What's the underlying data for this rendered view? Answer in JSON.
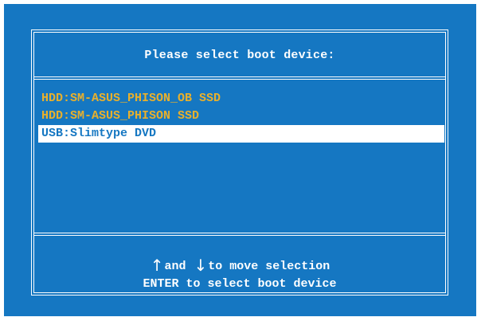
{
  "dialog": {
    "title": "Please select boot device:"
  },
  "devices": [
    {
      "label": "HDD:SM-ASUS_PHISON_OB SSD",
      "selected": false
    },
    {
      "label": "HDD:SM-ASUS_PHISON SSD",
      "selected": false
    },
    {
      "label": "USB:Slimtype DVD",
      "selected": true
    }
  ],
  "help": {
    "up_arrow": "↑",
    "and_text": "and",
    "down_arrow": "↓",
    "move_text": "to move selection",
    "enter_text": "ENTER to select boot device"
  },
  "colors": {
    "background": "#1577c2",
    "foreground": "#ffffff",
    "unselected_item": "#e8b02c",
    "selected_item_background": "#ffffff",
    "selected_item_text": "#1577c2"
  }
}
